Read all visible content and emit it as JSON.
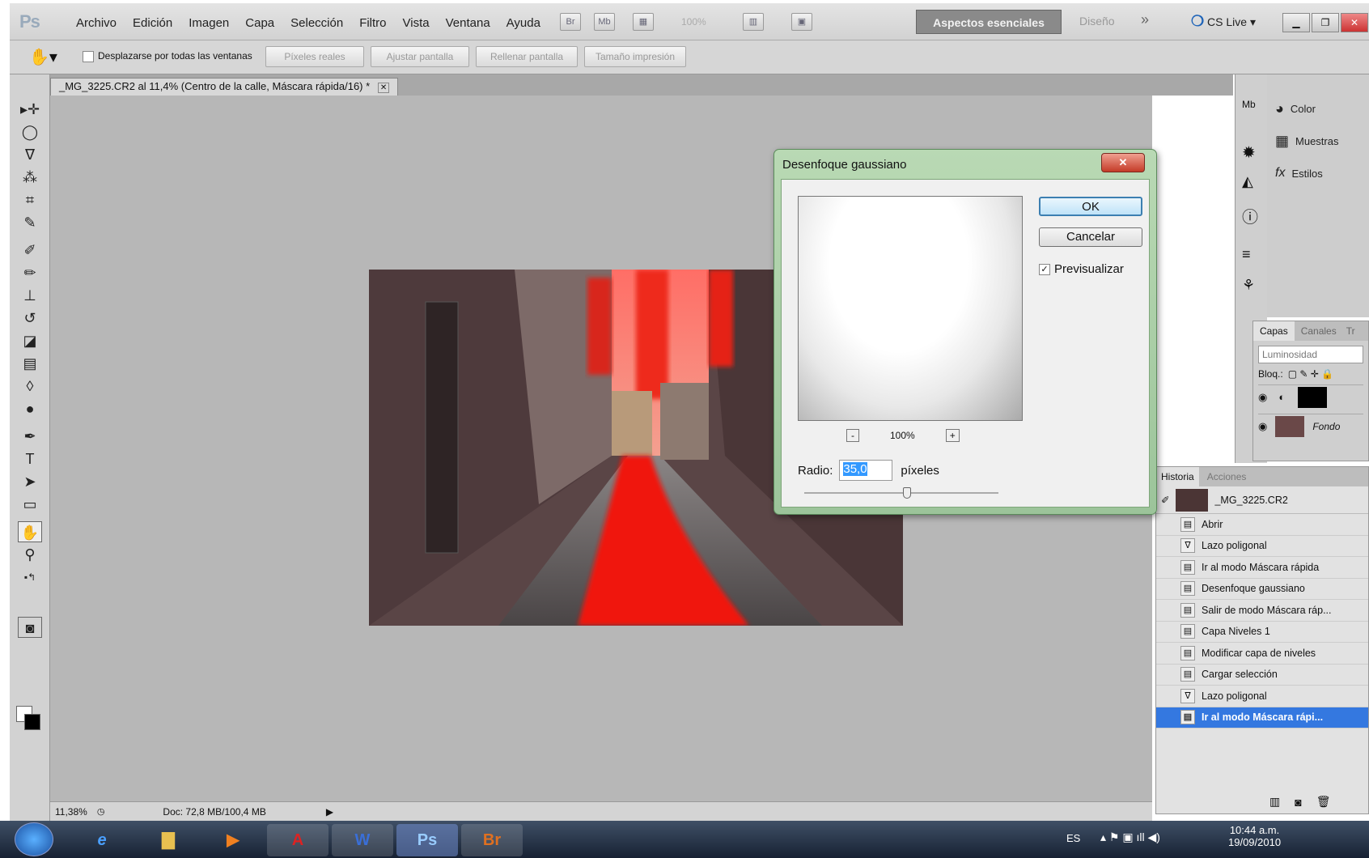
{
  "app": {
    "logo": "Ps"
  },
  "menu": [
    "Archivo",
    "Edición",
    "Imagen",
    "Capa",
    "Selección",
    "Filtro",
    "Vista",
    "Ventana",
    "Ayuda"
  ],
  "menubar": {
    "icons": [
      "Br",
      "Mb"
    ],
    "zoom": "100%",
    "workspace": "Aspectos esenciales",
    "design": "Diseño",
    "more": "»",
    "cslive": "CS Live ▾"
  },
  "options": {
    "scroll_all_label": "Desplazarse por todas las ventanas",
    "buttons": [
      "Píxeles reales",
      "Ajustar pantalla",
      "Rellenar pantalla",
      "Tamaño impresión"
    ]
  },
  "document": {
    "tab_title": "_MG_3225.CR2 al 11,4% (Centro de la calle, Máscara rápida/16) *"
  },
  "status": {
    "zoom": "11,38%",
    "doc": "Doc: 72,8 MB/100,4 MB"
  },
  "right_panels": {
    "items": [
      {
        "icon": "color-icon",
        "label": "Color"
      },
      {
        "icon": "swatches-icon",
        "label": "Muestras"
      },
      {
        "icon": "styles-icon",
        "label": "Estilos"
      }
    ]
  },
  "layers": {
    "tabs": [
      "Capas",
      "Canales",
      "Tr"
    ],
    "blend_mode": "Luminosidad",
    "lock_label": "Bloq.:",
    "background_layer": "Fondo"
  },
  "history": {
    "tabs": [
      "Historia",
      "Acciones"
    ],
    "snapshot": "_MG_3225.CR2",
    "items": [
      "Abrir",
      "Lazo poligonal",
      "Ir al modo Máscara rápida",
      "Desenfoque gaussiano",
      "Salir de modo Máscara ráp...",
      "Capa Niveles 1",
      "Modificar capa de niveles",
      "Cargar selección",
      "Lazo poligonal",
      "Ir al modo Máscara rápi..."
    ],
    "selected_index": 9
  },
  "dialog": {
    "title": "Desenfoque gaussiano",
    "ok": "OK",
    "cancel": "Cancelar",
    "preview_label": "Previsualizar",
    "preview_checked": true,
    "zoom": "100%",
    "zoom_out": "-",
    "zoom_in": "+",
    "radius_label": "Radio:",
    "radius_value": "35,0",
    "radius_unit": "píxeles"
  },
  "taskbar": {
    "apps": [
      "ie",
      "explorer",
      "media",
      "acrobat",
      "word",
      "Ps",
      "Br"
    ],
    "lang": "ES",
    "time": "10:44 a.m.",
    "date": "19/09/2010"
  }
}
